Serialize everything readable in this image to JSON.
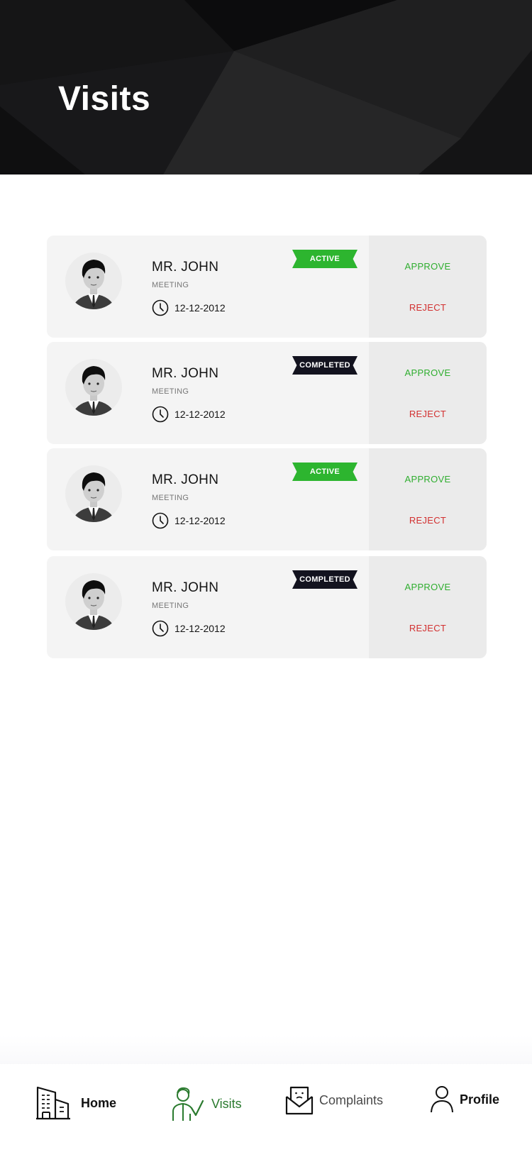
{
  "header": {
    "title": "Visits"
  },
  "visits": [
    {
      "name": "MR. JOHN",
      "purpose": "MEETING",
      "date": "12-12-2012",
      "status": "ACTIVE",
      "status_type": "active",
      "approve_label": "APPROVE",
      "reject_label": "REJECT"
    },
    {
      "name": "MR. JOHN",
      "purpose": "MEETING",
      "date": "12-12-2012",
      "status": "COMPLETED",
      "status_type": "completed",
      "approve_label": "APPROVE",
      "reject_label": "REJECT"
    },
    {
      "name": "MR. JOHN",
      "purpose": "MEETING",
      "date": "12-12-2012",
      "status": "ACTIVE",
      "status_type": "active",
      "approve_label": "APPROVE",
      "reject_label": "REJECT"
    },
    {
      "name": "MR. JOHN",
      "purpose": "MEETING",
      "date": "12-12-2012",
      "status": "COMPLETED",
      "status_type": "completed",
      "approve_label": "APPROVE",
      "reject_label": "REJECT"
    }
  ],
  "nav": {
    "items": [
      {
        "label": "Home",
        "icon": "building-icon"
      },
      {
        "label": "Visits",
        "icon": "visitor-icon",
        "active": true
      },
      {
        "label": "Complaints",
        "icon": "envelope-icon"
      },
      {
        "label": "Profile",
        "icon": "person-icon"
      }
    ]
  },
  "colors": {
    "active_badge": "#2db52f",
    "completed_badge": "#13131f",
    "approve": "#2fae2f",
    "reject": "#d23030",
    "nav_active": "#2a7a2e"
  }
}
